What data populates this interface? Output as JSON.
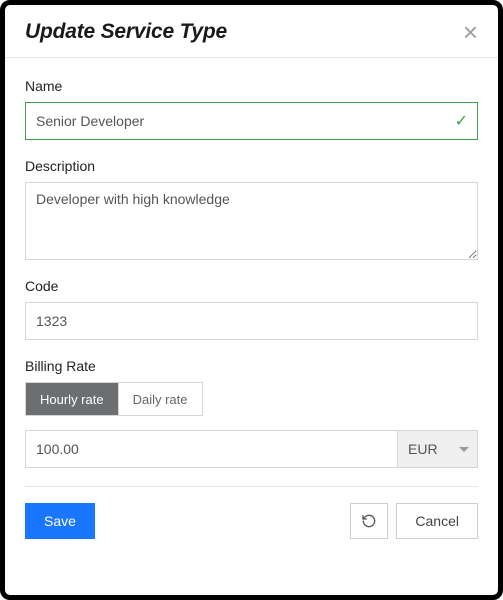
{
  "dialog": {
    "title": "Update Service Type",
    "close_symbol": "×"
  },
  "fields": {
    "name": {
      "label": "Name",
      "value": "Senior Developer",
      "valid": true
    },
    "description": {
      "label": "Description",
      "value": "Developer with high knowledge"
    },
    "code": {
      "label": "Code",
      "value": "1323"
    },
    "billing_rate": {
      "label": "Billing Rate",
      "toggle": {
        "hourly": "Hourly rate",
        "daily": "Daily rate",
        "active": "hourly"
      },
      "amount": "100.00",
      "currency": "EUR"
    }
  },
  "footer": {
    "save": "Save",
    "undo_icon": "undo-icon",
    "cancel": "Cancel"
  }
}
